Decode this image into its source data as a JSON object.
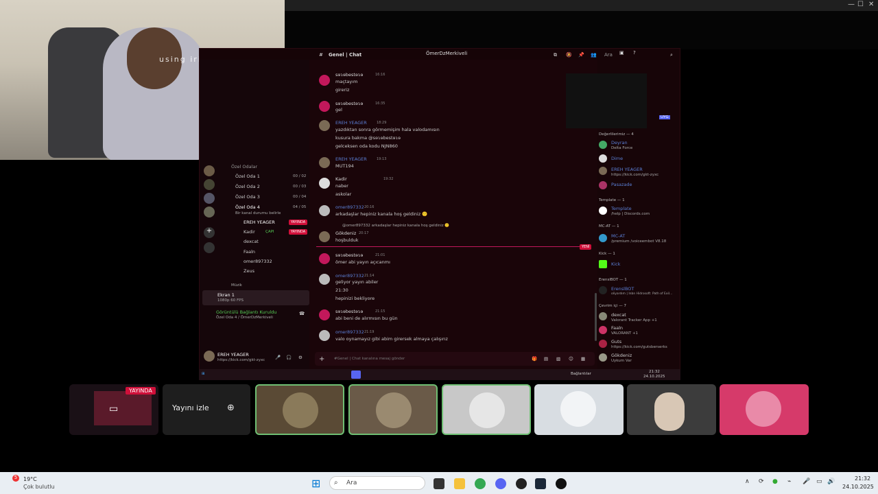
{
  "webcam": {
    "watermark": "using iriuncam app"
  },
  "discord": {
    "title": "ÖmerDzMerkiveli",
    "channel": "Genel | Chat",
    "search": "Ara",
    "input_placeholder": "#Genel | Chat kanalına mesaj gönder",
    "new_badge": "YENİ",
    "rooms_header": "Özel Odalar",
    "rooms": [
      {
        "name": "Özel Oda 1",
        "count": "00 / 02"
      },
      {
        "name": "Özel Oda 2",
        "count": "00 / 03"
      },
      {
        "name": "Özel Oda 3",
        "count": "00 / 04"
      },
      {
        "name": "Özel Oda 4",
        "count": "04 / 05"
      }
    ],
    "room4_sub": "Bir kanal durumu belirle",
    "room4_members": [
      "EREH YEAGER",
      "Kadir",
      "dexcat",
      "Faaln",
      "omer897332",
      "Zeus"
    ],
    "live": "YAYINDA",
    "capi": "ÇAPI",
    "music_header": "Müzik",
    "screen_share": {
      "title": "Ekran 1",
      "sub": "1080p 60 FPS"
    },
    "voice_status": {
      "title": "Görüntülü Bağlantı Kuruldu",
      "sub": "Özel Oda 4 / ÖmerDzMerkiveli"
    },
    "self": {
      "name": "EREH YEAGER",
      "sub": "https://kick.com/gkt-zyxc"
    },
    "messages": [
      {
        "name": "sɘɿɘbestɘɿɘ",
        "time": "16:16",
        "lines": [
          "maçtayım",
          "gireriz"
        ]
      },
      {
        "name": "sɘɿɘbestɘɿɘ",
        "time": "16:35",
        "lines": [
          "gel"
        ]
      },
      {
        "name": "EREH YEAGER",
        "time": "18:29",
        "lines": [
          "yazdıktan sonra görmemişim hala valodamısın",
          "kusura bakma @sɘɿɘbestɘɿɘ",
          "gelceksen oda kodu NJN860"
        ]
      },
      {
        "name": "EREH YEAGER",
        "time": "19:13",
        "lines": [
          "MUT194"
        ]
      },
      {
        "name": "Kadir",
        "time": "19:32",
        "lines": [
          "naber",
          "askolar"
        ]
      },
      {
        "name": "omer897332",
        "time": "20:16",
        "lines": [
          "arkadaşlar hepiniz kanala hoş geldiniz 🙂"
        ]
      },
      {
        "name": "Gökdeniz",
        "time": "20:17",
        "lines": [
          "hoşbulduk"
        ],
        "reply": "@omer897332 arkadaşlar hepiniz kanala hoş geldiniz 🙂"
      },
      {
        "name": "sɘɿɘbestɘɿɘ",
        "time": "21:01",
        "lines": [
          "ömer abi yayın açıcanmı"
        ]
      },
      {
        "name": "omer897332",
        "time": "21:14",
        "lines": [
          "geliyor yayın abiler",
          "21:30",
          "hepinizi bekliyore"
        ]
      },
      {
        "name": "sɘɿɘbestɘɿɘ",
        "time": "21:15",
        "lines": [
          "abi beni de alırmısın bu gün"
        ]
      },
      {
        "name": "omer897332",
        "time": "21:19",
        "lines": [
          "valo oynamayız gibi abim girersek almaya çalışırız"
        ]
      }
    ],
    "members": {
      "g1_header": "Değerlilerimiz — 4",
      "g1": [
        {
          "name": "Deyran",
          "sub": "Delta Force"
        },
        {
          "name": "Dime",
          "sub": ""
        },
        {
          "name": "EREH YEAGER",
          "sub": "https://kick.com/gkt-zyxc"
        },
        {
          "name": "Pasazade",
          "sub": ""
        }
      ],
      "g2_header": "Template — 1",
      "g2": [
        {
          "name": "Template",
          "sub": "/help | Discords.com"
        }
      ],
      "g3_header": "MC-AT — 1",
      "g3": [
        {
          "name": "MC-AT",
          "sub": "/premium /voiceembot V8.18"
        }
      ],
      "g4_header": "Kick — 1",
      "g4": [
        {
          "name": "Kick",
          "sub": ""
        }
      ],
      "g5_header": "ErenslBOT — 1",
      "g5": [
        {
          "name": "ErenslBOT",
          "sub": "oliyardım | Inbn Hidrosoft: Path of Exil..."
        }
      ],
      "g6_header": "Çevrim içi — 7",
      "g6": [
        {
          "name": "dexcat",
          "sub": "Valorant Tracker App +1"
        },
        {
          "name": "Faaln",
          "sub": "VALORANT +1"
        },
        {
          "name": "Guts",
          "sub": "https://kick.com/gutsberserks"
        },
        {
          "name": "Gökdeniz",
          "sub": "Uykum Var"
        }
      ],
      "bot_tag": "UYG"
    },
    "taskbar": {
      "status": "Bağlantılar",
      "time": "21:32",
      "date": "24.10.2025"
    }
  },
  "participants": {
    "live_label": "YAYINDA",
    "watch_button": "Yayını izle"
  },
  "taskbar": {
    "temp": "19°C",
    "weather": "Çok bulutlu",
    "search": "Ara",
    "notif": "5",
    "time": "21:32",
    "date": "24.10.2025"
  }
}
